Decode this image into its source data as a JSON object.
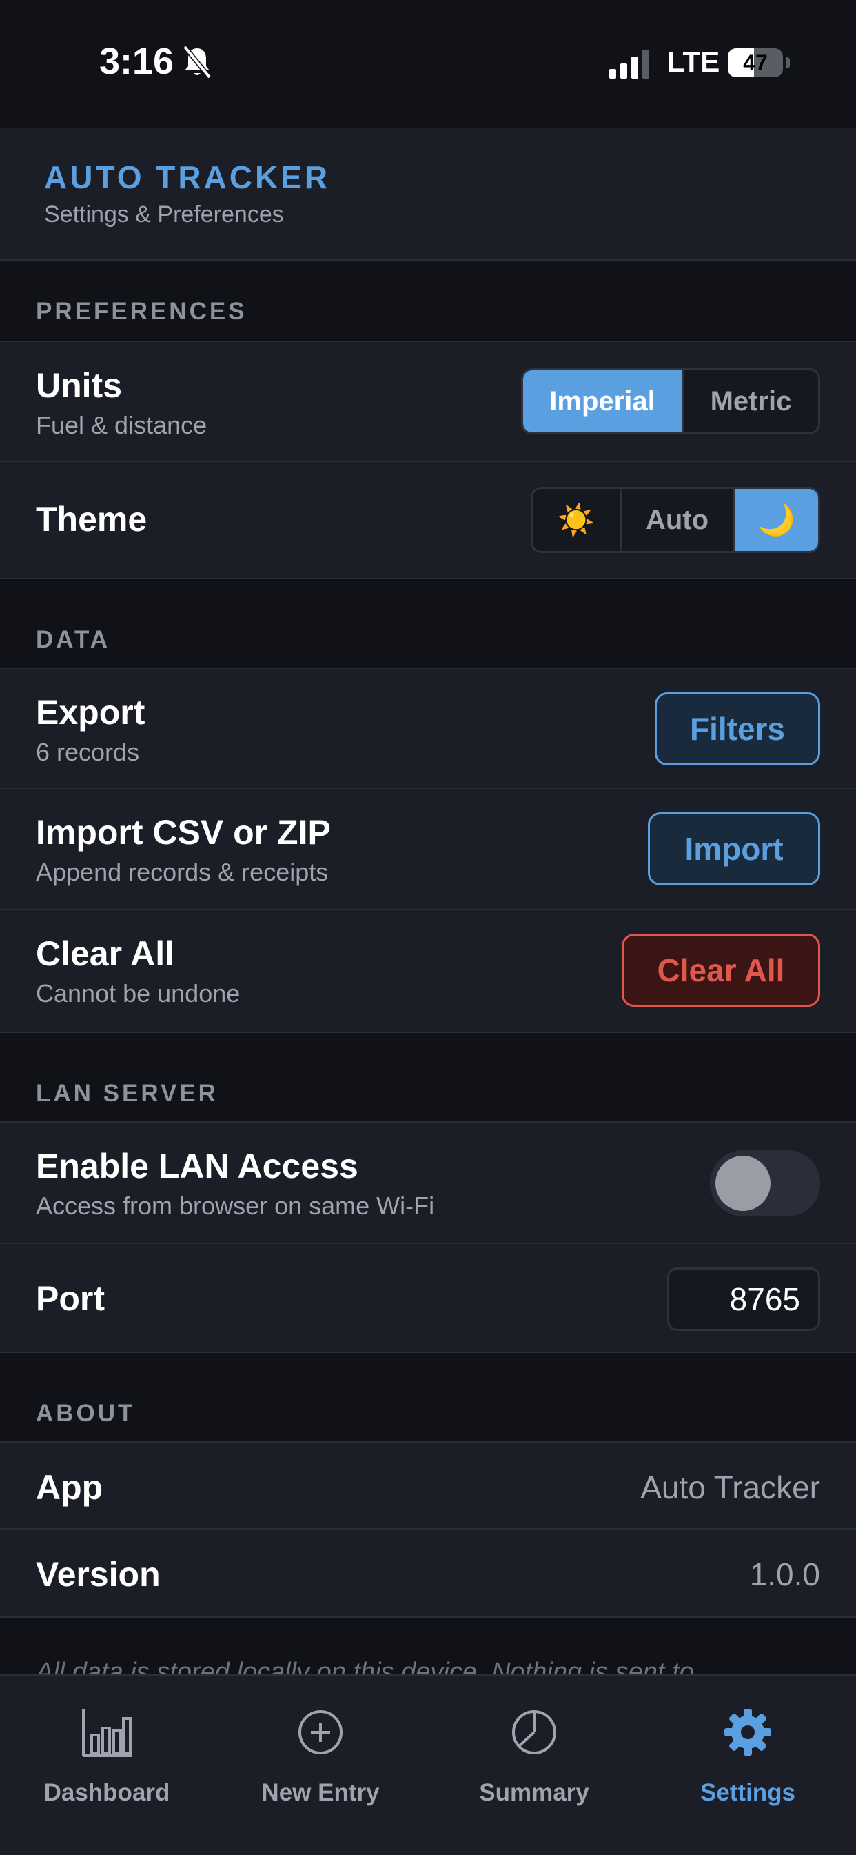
{
  "status_bar": {
    "time": "3:16",
    "network": "LTE",
    "battery_percent": 47,
    "battery_label": "47"
  },
  "header": {
    "title": "AUTO TRACKER",
    "subtitle": "Settings & Preferences"
  },
  "sections": {
    "preferences": "PREFERENCES",
    "data": "DATA",
    "lan_server": "LAN SERVER",
    "about": "ABOUT"
  },
  "preferences": {
    "units": {
      "title": "Units",
      "subtitle": "Fuel & distance",
      "options": [
        "Imperial",
        "Metric"
      ],
      "selected": "Imperial"
    },
    "theme": {
      "title": "Theme",
      "options": [
        {
          "label": "☀️",
          "icon": "sun-icon"
        },
        {
          "label": "Auto"
        },
        {
          "label": "🌙",
          "icon": "moon-icon"
        }
      ],
      "selected_index": 2
    }
  },
  "data": {
    "export": {
      "title": "Export",
      "subtitle": "6 records",
      "button": "Filters"
    },
    "import": {
      "title": "Import CSV or ZIP",
      "subtitle": "Append records & receipts",
      "button": "Import"
    },
    "clear": {
      "title": "Clear All",
      "subtitle": "Cannot be undone",
      "button": "Clear All"
    }
  },
  "lan": {
    "enable": {
      "title": "Enable LAN Access",
      "subtitle": "Access from browser on same Wi-Fi",
      "enabled": false
    },
    "port": {
      "title": "Port",
      "value": "8765"
    }
  },
  "about": {
    "app": {
      "title": "App",
      "value": "Auto Tracker"
    },
    "version": {
      "title": "Version",
      "value": "1.0.0"
    }
  },
  "footer_note": "All data is stored locally on this device. Nothing is sent to",
  "tabs": [
    {
      "label": "Dashboard",
      "icon": "bar-chart-icon",
      "active": false
    },
    {
      "label": "New Entry",
      "icon": "plus-circle-icon",
      "active": false
    },
    {
      "label": "Summary",
      "icon": "pie-chart-icon",
      "active": false
    },
    {
      "label": "Settings",
      "icon": "gear-icon",
      "active": true
    }
  ],
  "colors": {
    "accent": "#5a9fe0",
    "danger": "#e0574c",
    "background": "#111217",
    "surface": "#1b1e27"
  }
}
